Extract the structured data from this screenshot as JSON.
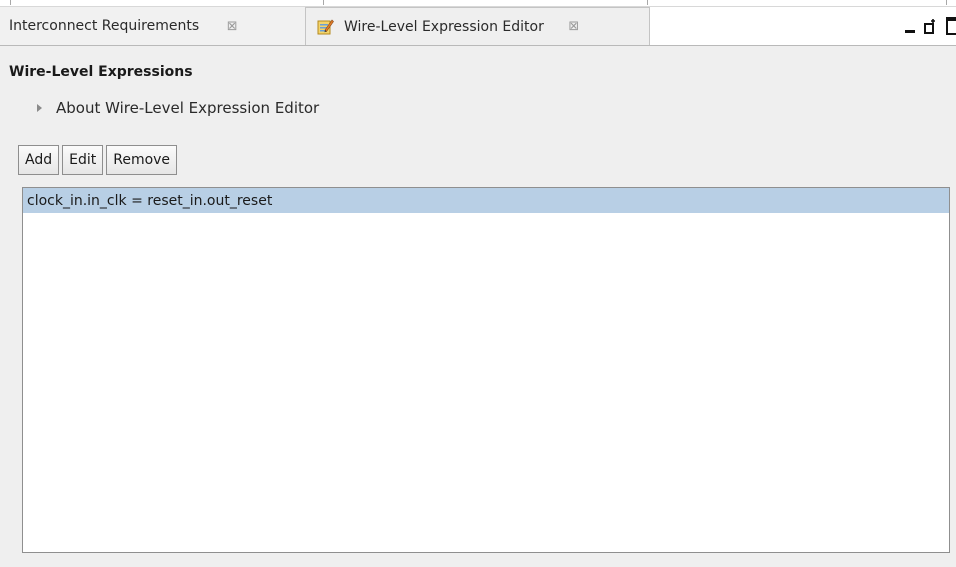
{
  "tabs": [
    {
      "label": "Interconnect Requirements",
      "close": "⊠",
      "active": false
    },
    {
      "label": "Wire-Level Expression Editor",
      "close": "⊠",
      "icon": "editor-icon",
      "active": true
    }
  ],
  "window_controls": {
    "minimize": "minimize-icon",
    "restore": "restore-icon",
    "maximize": "maximize-icon"
  },
  "section": {
    "title": "Wire-Level Expressions",
    "about": "About Wire-Level Expression Editor"
  },
  "toolbar": {
    "add_label": "Add",
    "edit_label": "Edit",
    "remove_label": "Remove"
  },
  "expressions": [
    {
      "text": "clock_in.in_clk = reset_in.out_reset",
      "selected": true
    }
  ],
  "colors": {
    "selection": "#b8cfe5",
    "panel_bg": "#efefef"
  }
}
